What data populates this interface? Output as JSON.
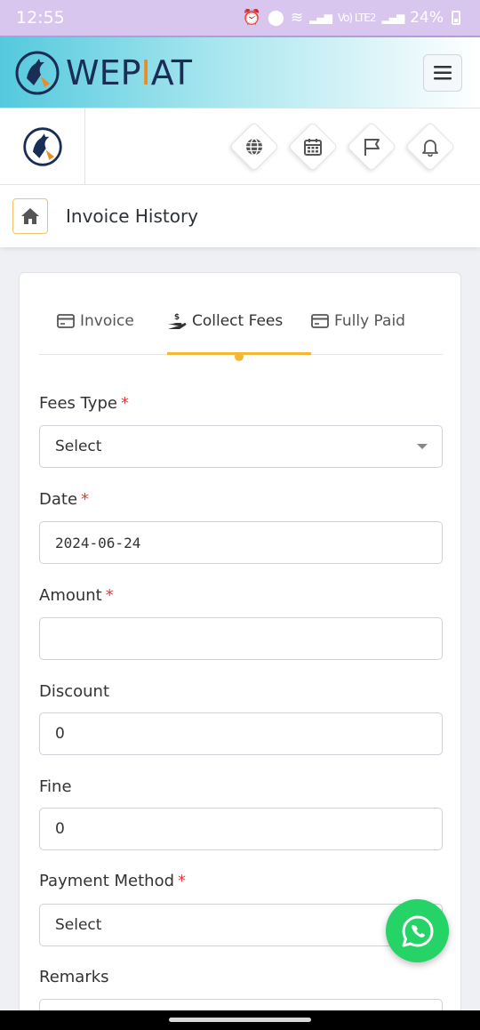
{
  "status_bar": {
    "time": "12:55",
    "net_label": "Vo) LTE2",
    "battery": "24%"
  },
  "header": {
    "brand_prefix": "WEP",
    "brand_accent": "I",
    "brand_suffix": "AT",
    "brand_colors": {
      "text": "#1a2d55",
      "accent": "#f08a1c"
    }
  },
  "toolbar": {
    "icons": [
      "globe-icon",
      "calendar-icon",
      "flag-icon",
      "bell-icon"
    ]
  },
  "breadcrumb": {
    "title": "Invoice History"
  },
  "tabs": [
    {
      "label": "Invoice",
      "icon": "card-icon",
      "active": false
    },
    {
      "label": "Collect Fees",
      "icon": "hand-dollar-icon",
      "active": true
    },
    {
      "label": "Fully Paid",
      "icon": "card-icon",
      "active": false
    }
  ],
  "form": {
    "fees_type": {
      "label": "Fees Type",
      "required": "*",
      "value": "Select"
    },
    "date": {
      "label": "Date",
      "required": "*",
      "value": "2024-06-24"
    },
    "amount": {
      "label": "Amount",
      "required": "*",
      "value": ""
    },
    "discount": {
      "label": "Discount",
      "value": "0"
    },
    "fine": {
      "label": "Fine",
      "value": "0"
    },
    "payment_method": {
      "label": "Payment Method",
      "required": "*",
      "value": "Select"
    },
    "remarks": {
      "label": "Remarks",
      "value": ""
    }
  },
  "colors": {
    "tab_accent": "#f5b731",
    "required": "#e23b3b",
    "whatsapp": "#25d366"
  }
}
